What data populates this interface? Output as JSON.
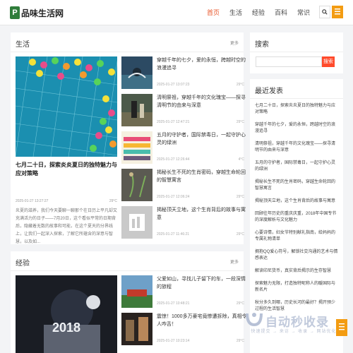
{
  "header": {
    "logo_mark": "P",
    "logo_text": "品味生活网",
    "nav": [
      "首页",
      "生活",
      "经验",
      "百科",
      "常识"
    ]
  },
  "life": {
    "title": "生活",
    "more": "更多",
    "feature": {
      "title": "七月二十日，探索炎炎夏日的独特魅力与应对策略",
      "date": "2025-01-27 13:27:27",
      "temp": "29°C",
      "excerpt": "炎夏的滋养，我们今天要聊一聊那个在日历上平凡却又充满活力的日子——7月20日，这个看似平常的日期背后，隐藏着无数的故事和可能，在这个夏天的分界线上，让我们一起深入探索，了解它所蕴含的深意与智慧，以及如..."
    },
    "items": [
      {
        "title": "穿越千年的七夕，爱的永恒，跨越时空的浪漫追寻",
        "date": "2025-01-27 13:07:23",
        "temp": "29°C"
      },
      {
        "title": "清明祭祖，穿越千年的文化瑰宝——探寻清明节的由来与深意",
        "date": "2025-01-27 12:47:21",
        "temp": "29°C"
      },
      {
        "title": "五月的守护者，国际禁毒日，一起守护心灵的绿洲",
        "date": "2025-01-27 12:26:44",
        "temp": "4°C"
      },
      {
        "title": "揭秘长生不死的生肖密码，穿越生命轮回的智慧寓言",
        "date": "2025-01-27 12:06:24",
        "temp": "29°C"
      },
      {
        "title": "揭秘顶天立地，这个生肖背后的故事与寓意",
        "date": "2025-01-27 11:46:21",
        "temp": "29°C"
      }
    ]
  },
  "experience": {
    "title": "经验",
    "more": "更多",
    "feature_text": "2018",
    "items": [
      {
        "title": "父爱如山，寻找儿子留下的车，一段深情的旅程",
        "date": "2025-01-27 10:48:21",
        "temp": "29°C"
      },
      {
        "title": "震惊！1000多万豪宅竟惨遭拆除，真相令人咋舌！",
        "date": "2025-01-27 10:23:14",
        "temp": "29°C"
      }
    ]
  },
  "sidebar": {
    "search_title": "搜索",
    "search_button": "搜索",
    "recent_title": "最近发表",
    "recent": [
      "七月二十日，探索炎炎夏日的独特魅力与应对策略",
      "穿越千年的七夕，爱的永恒，跨越时空的浪漫追寻",
      "清明祭祖，穿越千年的文化瑰宝——探寻清明节的由来与深意",
      "五月的守护者，国际禁毒日，一起守护心灵的绿洲",
      "揭秘长生不死的生肖密码，穿越生命轮回的智慧寓言",
      "揭秘顶天立地，这个生肖背后的故事与寓意",
      "回顾往年历史的重庆庆重，2018年中国专节的深度解析与文化魅力",
      "心要诗情，妇女节特别献礼指南，给妈妈的专属礼物清单",
      "拥抱QQ爱心符号，解锁社交沟通的艺术与情感表达",
      "解读印尼货币，真实背后揭示的生存智慧",
      "探索魅力无限，打造独特昵称人的暖国际与新名片",
      "秋分多久到哪，历史长河的最好？揭开预少过程的生活智慧"
    ]
  },
  "watermark": {
    "title": "自动秒收录",
    "sub": "快速提交 → 来访 → 收录 → 网站优化"
  }
}
